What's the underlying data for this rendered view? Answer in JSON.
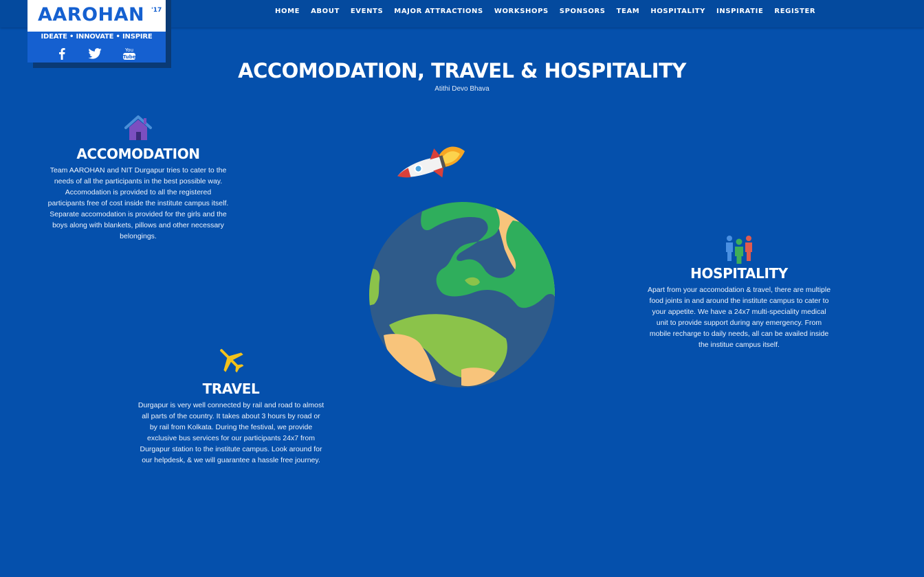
{
  "logo": {
    "word": "AAROHAN",
    "year": "'17",
    "tagline": "IDEATE • INNOVATE • INSPIRE",
    "social": [
      "facebook-icon",
      "twitter-icon",
      "youtube-icon"
    ],
    "youtube_text": {
      "top": "You",
      "bottom": "Tube"
    }
  },
  "nav": {
    "items": [
      "HOME",
      "ABOUT",
      "EVENTS",
      "MAJOR ATTRACTIONS",
      "WORKSHOPS",
      "SPONSORS",
      "TEAM",
      "HOSPITALITY",
      "INSPIRATIE",
      "REGISTER"
    ]
  },
  "page": {
    "title": "ACCOMODATION, TRAVEL & HOSPITALITY",
    "subtitle": "Atithi Devo Bhava"
  },
  "sections": {
    "accomodation": {
      "icon": "house-icon",
      "title": "ACCOMODATION",
      "text": "Team AAROHAN and NIT Durgapur tries to cater to the needs of all the participants in the best possible way. Accomodation is provided to all the registered participants free of cost inside the institute campus itself. Separate accomodation is provided for the girls and the boys along with blankets, pillows and other necessary belongings."
    },
    "travel": {
      "icon": "airplane-icon",
      "title": "TRAVEL",
      "text": "Durgapur is very well connected by rail and road to almost all parts of the country. It takes about 3 hours by road or by rail from Kolkata. During the festival, we provide exclusive bus services for our participants 24x7 from Durgapur station to the institute campus. Look around for our helpdesk, & we will guarantee a hassle free journey."
    },
    "hospitality": {
      "icon": "people-icon",
      "title": "HOSPITALITY",
      "text": "Apart from your accomodation & travel, there are multiple food joints in and around the institute campus to cater to your appetite. We have a 24x7 multi-speciality medical unit to provide support during any emergency. From mobile recharge to daily needs, all can be availed inside the institue campus itself."
    }
  },
  "illustration": {
    "globe": "globe-illustration",
    "rocket": "rocket-illustration"
  },
  "colors": {
    "background": "#0550ac",
    "navbar": "#044a9e",
    "brand": "#1560d0",
    "house": "#7b4fc0",
    "airplane": "#f3c21b",
    "ocean": "#2f5b8a",
    "land_green": "#2fae5c",
    "land_light": "#8bc34a",
    "land_sand": "#f8c47b"
  }
}
